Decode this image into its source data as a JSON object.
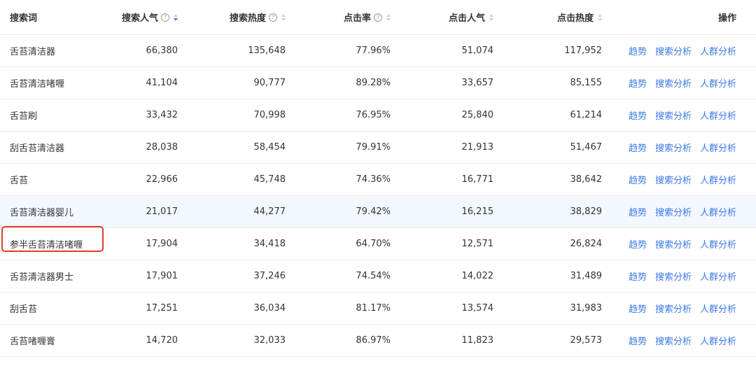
{
  "headers": {
    "keyword": "搜索词",
    "search_popularity": "搜索人气",
    "search_heat": "搜索热度",
    "ctr": "点击率",
    "click_popularity": "点击人气",
    "click_heat": "点击热度",
    "ops": "操作"
  },
  "help_glyph": "?",
  "sort_state": {
    "search_popularity": "descending"
  },
  "rows": [
    {
      "keyword": "舌苔清洁器",
      "search_popularity": "66,380",
      "search_heat": "135,648",
      "ctr": "77.96%",
      "click_popularity": "51,074",
      "click_heat": "117,952"
    },
    {
      "keyword": "舌苔清洁啫喱",
      "search_popularity": "41,104",
      "search_heat": "90,777",
      "ctr": "89.28%",
      "click_popularity": "33,657",
      "click_heat": "85,155"
    },
    {
      "keyword": "舌苔刷",
      "search_popularity": "33,432",
      "search_heat": "70,998",
      "ctr": "76.95%",
      "click_popularity": "25,840",
      "click_heat": "61,214"
    },
    {
      "keyword": "刮舌苔清洁器",
      "search_popularity": "28,038",
      "search_heat": "58,454",
      "ctr": "79.91%",
      "click_popularity": "21,913",
      "click_heat": "51,467"
    },
    {
      "keyword": "舌苔",
      "search_popularity": "22,966",
      "search_heat": "45,748",
      "ctr": "74.36%",
      "click_popularity": "16,771",
      "click_heat": "38,642"
    },
    {
      "keyword": "舌苔清洁器婴儿",
      "search_popularity": "21,017",
      "search_heat": "44,277",
      "ctr": "79.42%",
      "click_popularity": "16,215",
      "click_heat": "38,829"
    },
    {
      "keyword": "参半舌苔清洁啫喱",
      "search_popularity": "17,904",
      "search_heat": "34,418",
      "ctr": "64.70%",
      "click_popularity": "12,571",
      "click_heat": "26,824"
    },
    {
      "keyword": "舌苔清洁器男士",
      "search_popularity": "17,901",
      "search_heat": "37,246",
      "ctr": "74.54%",
      "click_popularity": "14,022",
      "click_heat": "31,489"
    },
    {
      "keyword": "刮舌苔",
      "search_popularity": "17,251",
      "search_heat": "36,034",
      "ctr": "81.17%",
      "click_popularity": "13,574",
      "click_heat": "31,983"
    },
    {
      "keyword": "舌苔啫喱膏",
      "search_popularity": "14,720",
      "search_heat": "32,033",
      "ctr": "86.97%",
      "click_popularity": "11,823",
      "click_heat": "29,573"
    }
  ],
  "actions": [
    "趋势",
    "搜索分析",
    "人群分析"
  ],
  "highlighted_row_index": 5,
  "annotated_row_index": 6,
  "colors": {
    "link": "#3a78e7",
    "annotation": "#e23c2b",
    "row_highlight": "#f3f7ff"
  }
}
